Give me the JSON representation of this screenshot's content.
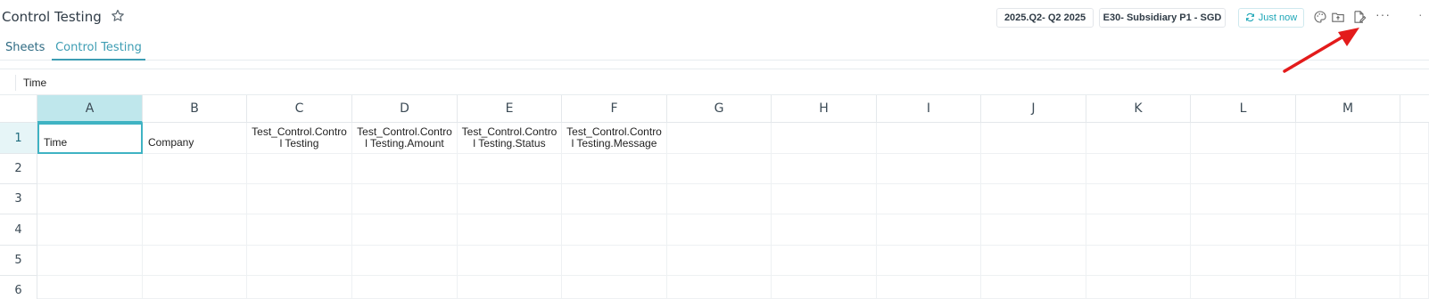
{
  "header": {
    "title": "Control Testing",
    "period": "2025.Q2- Q2 2025",
    "entity": "E30- Subsidiary P1 - SGD",
    "refresh_label": "Just now",
    "more_label": "···",
    "icons": [
      "star-icon",
      "palette-icon",
      "folder-upload-icon",
      "edit-document-icon",
      "more-icon"
    ]
  },
  "tabs": [
    {
      "label": "Sheets"
    },
    {
      "label": "Control Testing"
    }
  ],
  "formula_bar": {
    "value": "Time"
  },
  "sheet": {
    "columns": [
      "A",
      "B",
      "C",
      "D",
      "E",
      "F",
      "G",
      "H",
      "I",
      "J",
      "K",
      "L",
      "M"
    ],
    "rows": [
      "1",
      "2",
      "3",
      "4",
      "5",
      "6"
    ],
    "row1": [
      "Time",
      "Company",
      "Test_Control.Contro l Testing",
      "Test_Control.Contro l Testing.Amount",
      "Test_Control.Contro l Testing.Status",
      "Test_Control.Contro l Testing.Message"
    ],
    "row1_lines": [
      [
        "Test_Control.Contro",
        "l Testing"
      ],
      [
        "Test_Control.Contro",
        "l Testing.Amount"
      ],
      [
        "Test_Control.Contro",
        "l Testing.Status"
      ],
      [
        "Test_Control.Contro",
        "l Testing.Message"
      ]
    ]
  },
  "colors": {
    "accent": "#3fb3c3",
    "selected_header": "#bfe7ec",
    "annotation_arrow": "#e31b1b"
  }
}
